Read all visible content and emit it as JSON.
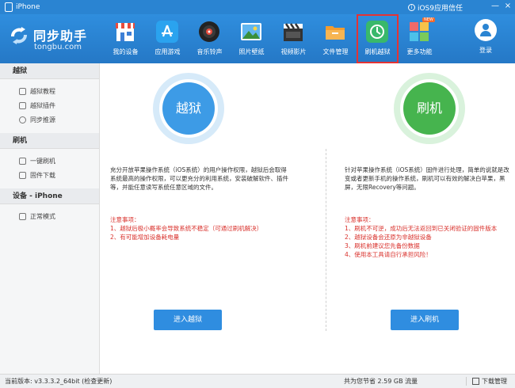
{
  "titlebar": {
    "device_name": "iPhone",
    "notice": "iOS9应用信任",
    "minimize_glyph": "—",
    "close_glyph": "×"
  },
  "logo": {
    "name": "同步助手",
    "url": "tongbu.com"
  },
  "nav": {
    "items": [
      {
        "label": "我的设备",
        "icon": "store-icon",
        "color": "#e84b3c"
      },
      {
        "label": "应用游戏",
        "icon": "app-store-icon",
        "color": "#2aa3ef"
      },
      {
        "label": "音乐铃声",
        "icon": "music-disc-icon",
        "color": "#222222"
      },
      {
        "label": "照片壁纸",
        "icon": "photo-icon",
        "color": "#2b6fc8"
      },
      {
        "label": "视频影片",
        "icon": "film-clapper-icon",
        "color": "#333333"
      },
      {
        "label": "文件管理",
        "icon": "folder-icon",
        "color": "#f39c2f"
      },
      {
        "label": "刷机越狱",
        "icon": "flash-jailbreak-icon",
        "color": "#39b86b",
        "active": true
      },
      {
        "label": "更多功能",
        "icon": "more-apps-icon",
        "color": "#f06a6a",
        "badge": "NEW"
      }
    ],
    "login_label": "登录"
  },
  "sidebar": {
    "sections": [
      {
        "title": "越狱",
        "items": [
          "越狱教程",
          "越狱插件",
          "同步推源"
        ]
      },
      {
        "title": "刷机",
        "items": [
          "一键刷机",
          "固件下载"
        ]
      },
      {
        "title": "设备 - iPhone",
        "items": [
          "正常模式"
        ]
      }
    ]
  },
  "jailbreak": {
    "circle_label": "越狱",
    "description": "充分开放苹果操作系统（iOS系统）的用户操作权限，越狱后会取得系统最高的操作权限，可以更充分的利用系统，安装破解软件、插件等，并能任意读写系统任意区域的文件。",
    "notes_title": "注意事项：",
    "notes": [
      "1、越狱后极小概率会导致系统不稳定（可通过刷机解决）",
      "2、有可能增加设备耗电量"
    ],
    "button": "进入越狱"
  },
  "flash": {
    "circle_label": "刷机",
    "description": "针对苹果操作系统（iOS系统）固件进行处理，简单的说就是改变或者更新手机的操作系统，刷机可以有效的解决白苹果，黑屏，无限Recovery等问题。",
    "notes_title": "注意事项：",
    "notes": [
      "1、刷机不可逆，成功后无法返回到已关闭验证的固件版本",
      "2、越狱设备会还原为非越狱设备",
      "3、刷机前建议您先备份数据",
      "4、使用本工具请自行承担风险！"
    ],
    "button": "进入刷机"
  },
  "statusbar": {
    "version": "当前版本: v3.3.3.2_64bit  (检查更新)",
    "saved": "共为您节省  2.59 GB 流量",
    "download_manager": "下载管理"
  }
}
